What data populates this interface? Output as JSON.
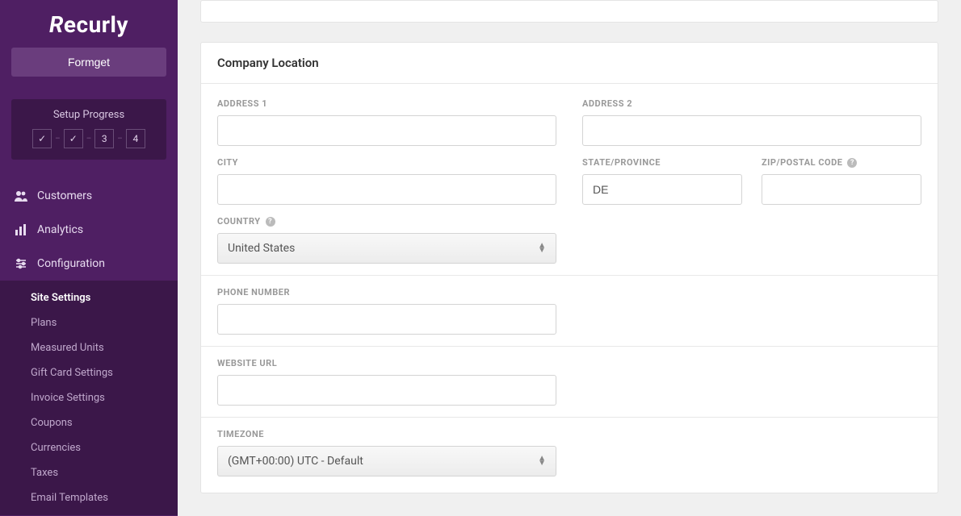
{
  "brand": "Recurly",
  "site_button": "Formget",
  "progress": {
    "title": "Setup Progress",
    "steps": [
      "check",
      "check",
      "3",
      "4"
    ]
  },
  "nav": {
    "customers": "Customers",
    "analytics": "Analytics",
    "configuration": "Configuration"
  },
  "subnav": [
    "Site Settings",
    "Plans",
    "Measured Units",
    "Gift Card Settings",
    "Invoice Settings",
    "Coupons",
    "Currencies",
    "Taxes",
    "Email Templates"
  ],
  "panel": {
    "title": "Company Location",
    "labels": {
      "address1": "ADDRESS 1",
      "address2": "ADDRESS 2",
      "city": "CITY",
      "state": "STATE/PROVINCE",
      "zip": "ZIP/POSTAL CODE",
      "country": "COUNTRY",
      "phone": "PHONE NUMBER",
      "website": "WEBSITE URL",
      "timezone": "TIMEZONE"
    },
    "values": {
      "address1": "",
      "address2": "",
      "city": "",
      "state": "DE",
      "zip": "",
      "country": "United States",
      "phone": "",
      "website": "",
      "timezone": "(GMT+00:00) UTC - Default"
    }
  }
}
